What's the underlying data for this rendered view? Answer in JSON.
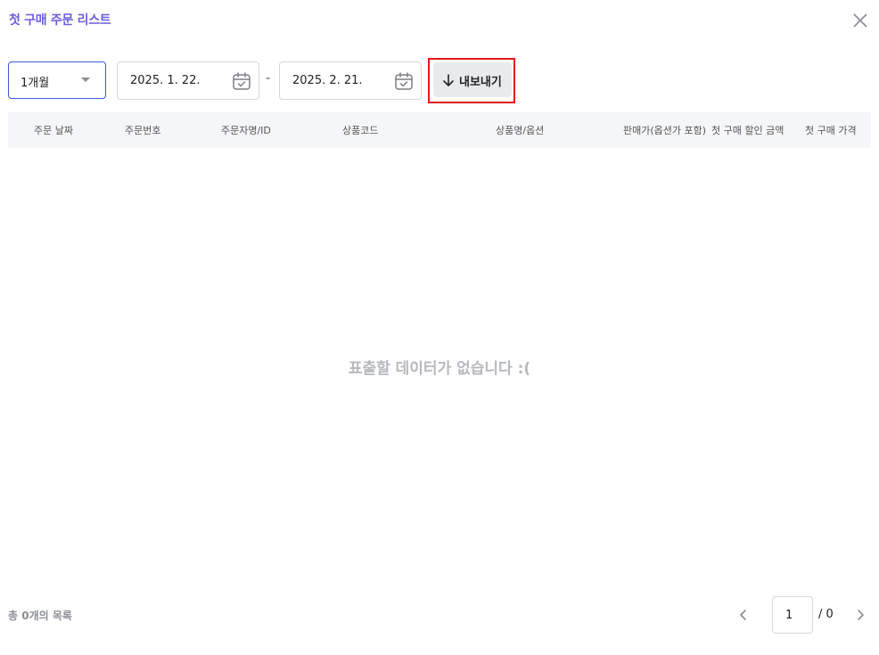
{
  "modal": {
    "title": "첫 구매 주문 리스트",
    "close_icon": "close-icon"
  },
  "filters": {
    "period": {
      "selected": "1개월",
      "icon": "caret-down-icon"
    },
    "date_from": "2025. 1. 22.",
    "date_to": "2025. 2. 21.",
    "separator": "-",
    "calendar_icon": "calendar-check-icon"
  },
  "export": {
    "label": "내보내기",
    "icon": "arrow-down-icon",
    "highlight_color": "#e0191b"
  },
  "table": {
    "columns": [
      "주문 날짜",
      "주문번호",
      "주문자명/ID",
      "상품코드",
      "상품명/옵션",
      "판매가(옵션가 포함)",
      "첫 구매 할인 금액",
      "첫 구매 가격"
    ],
    "rows": [],
    "empty_message": "표출할 데이터가 없습니다 :("
  },
  "footer": {
    "total_text": "총 0개의 목록",
    "page_input": "1",
    "page_total": "/ 0"
  },
  "colors": {
    "title": "#6a5ee0",
    "select_border": "#3a5bd9",
    "header_bg": "#f5f6f8"
  }
}
